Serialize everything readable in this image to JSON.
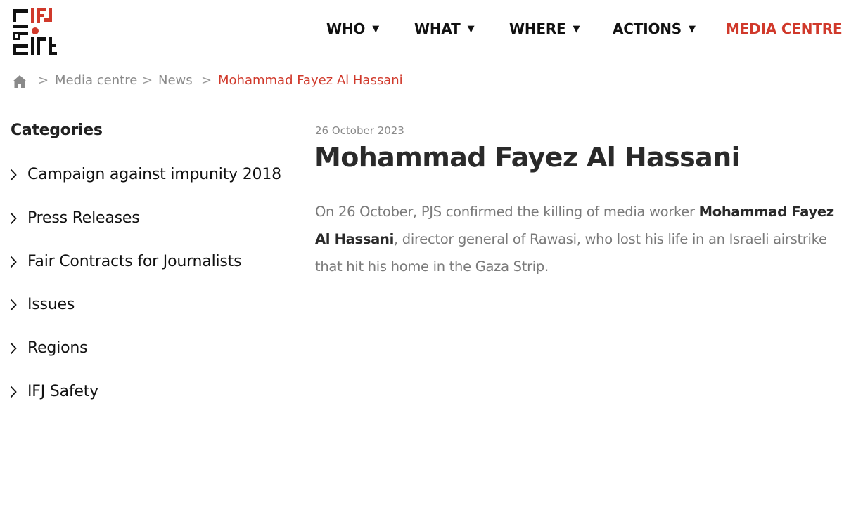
{
  "colors": {
    "accent": "#d0392b",
    "text_dark": "#111111",
    "text_muted": "#8a8a8a",
    "logo_red": "#d0392b",
    "logo_black": "#111111"
  },
  "logo": {
    "text_top": "IFJ",
    "text_side": "FIP",
    "text_bottom": "IJF"
  },
  "nav": {
    "items": [
      {
        "label": "WHO",
        "caret": "▼"
      },
      {
        "label": "WHAT",
        "caret": "▼"
      },
      {
        "label": "WHERE",
        "caret": "▼"
      },
      {
        "label": "ACTIONS",
        "caret": "▼"
      },
      {
        "label": "MEDIA CENTRE",
        "caret": "▼",
        "active": true
      }
    ]
  },
  "breadcrumb": {
    "home_icon": "home-icon",
    "separator": ">",
    "items": [
      "Media centre",
      "News",
      "Mohammad Fayez Al Hassani"
    ]
  },
  "sidebar": {
    "title": "Categories",
    "chevron_icon": "chevron-right-icon",
    "items": [
      {
        "label": "Campaign against impunity 2018"
      },
      {
        "label": "Press Releases"
      },
      {
        "label": "Fair Contracts for Journalists"
      },
      {
        "label": "Issues"
      },
      {
        "label": "Regions"
      },
      {
        "label": "IFJ Safety"
      }
    ]
  },
  "article": {
    "date": "26 October 2023",
    "title": "Mohammad Fayez Al Hassani",
    "body_before": "On 26 October, PJS confirmed the killing of media worker ",
    "body_name": "Mohammad Fayez Al Hassani",
    "body_after": ", director general of Rawasi, who lost his life in an Israeli airstrike that hit his home in the Gaza Strip."
  }
}
